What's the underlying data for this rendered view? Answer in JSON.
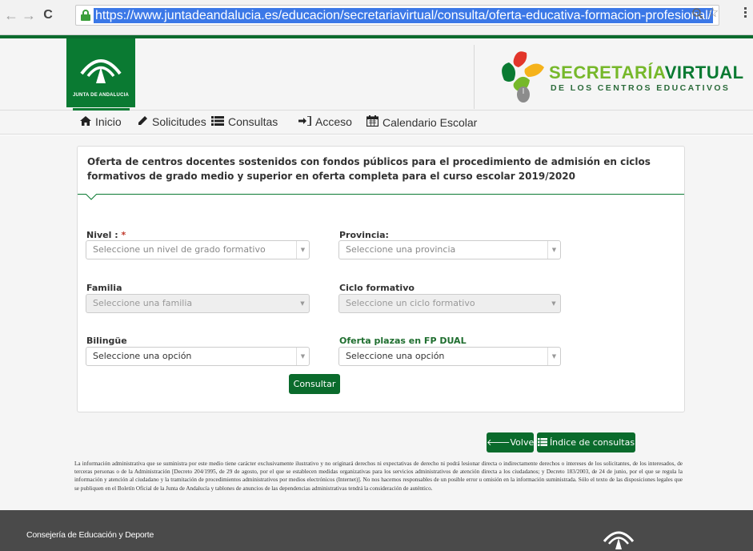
{
  "browser": {
    "url": "https://www.juntadeandalucia.es/educacion/secretariavirtual/consulta/oferta-educativa-formacion-profesional/",
    "back_icon": "arrow-left-icon",
    "forward_icon": "arrow-right-icon",
    "reload_icon": "reload-icon",
    "secure_icon": "lock-icon"
  },
  "header": {
    "junta_logo_text": "JUNTA DE ANDALUCIA",
    "brand_title_part1": "SECRETARÍA",
    "brand_title_part2": "VIRTUAL",
    "brand_subtitle": "DE LOS CENTROS EDUCATIVOS",
    "colors": {
      "primary_green": "#0a7a32",
      "light_green": "#76b82a"
    }
  },
  "nav": {
    "items": [
      {
        "label": "Inicio",
        "icon": "home-icon"
      },
      {
        "label": "Solicitudes",
        "icon": "pencil-icon"
      },
      {
        "label": "Consultas",
        "icon": "list-icon"
      },
      {
        "label": "Acceso",
        "icon": "sign-in-icon"
      },
      {
        "label": "Calendario Escolar",
        "icon": "calendar-icon"
      }
    ]
  },
  "form": {
    "title": "Oferta de centros docentes sostenidos con fondos públicos para el procedimiento de admisión en ciclos formativos de grado medio y superior en oferta completa para el curso escolar 2019/2020",
    "nivel_label": "Nivel :",
    "required_mark": "*",
    "nivel_placeholder": "Seleccione un nivel de grado formativo",
    "provincia_label": "Provincia:",
    "provincia_placeholder": "Seleccione una provincia",
    "familia_label": "Familia",
    "familia_placeholder": "Seleccione una familia",
    "ciclo_label": "Ciclo formativo",
    "ciclo_placeholder": "Seleccione un ciclo formativo",
    "bilingue_label": "Bilingüe",
    "bilingue_value": "Seleccione una opción",
    "dual_label": "Oferta plazas en FP DUAL",
    "dual_value": "Seleccione una opción",
    "submit_label": "Consultar"
  },
  "actions": {
    "back_label": "Volver",
    "index_label": "Índice de consultas"
  },
  "disclaimer": "La información administrativa que se suministra por este medio tiene carácter exclusivamente ilustrativo y no originará derechos ni expectativas de derecho ni podrá lesionar directa o indirectamente derechos o intereses de los solicitantes, de los interesados, de terceras personas o de la Administración [Decreto 204/1995, de 29 de agosto, por el que se establecen medidas organizativas para los servicios administrativos de atención directa a los ciudadanos; y Decreto 183/2003, de 24 de junio, por el que se regula la información y atención al ciudadano y la tramitación de procedimientos administrativos por medios electrónicos (Internet)]. No nos hacemos responsables de un posible error u omisión en la información suministrada. Sólo el texto de las disposiciones legales que se publiquen en el Boletín Oficial de la Junta de Andalucía y tablones de anuncios de las dependencias administrativas tendrá la consideración de auténtico.",
  "footer": {
    "text": "Consejería de Educación y Deporte"
  }
}
